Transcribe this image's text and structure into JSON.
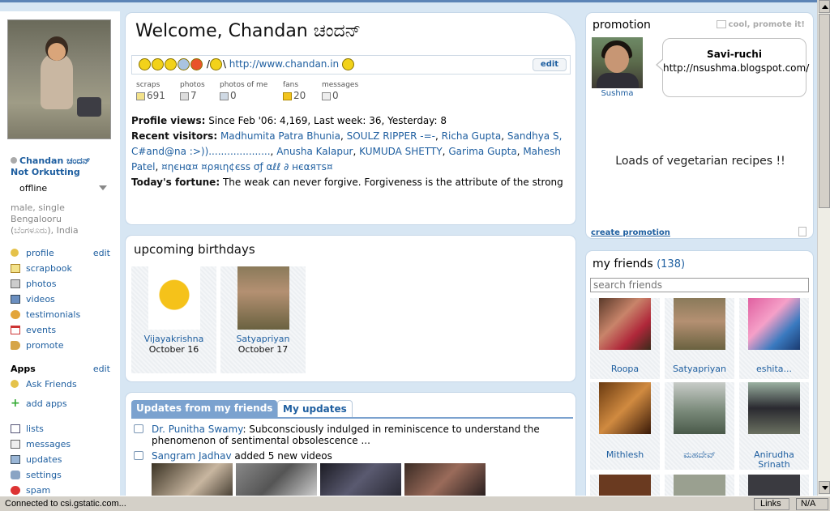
{
  "user": {
    "name": "Chandan ಚಂದನ್",
    "subtitle": "Not Orkutting",
    "status": "offline",
    "info_line1": "male, single",
    "info_line2": "Bengalooru",
    "info_line3": "(ಬೆಂಗಳೂರು), India"
  },
  "nav": {
    "edit": "edit",
    "items": [
      {
        "label": "profile",
        "icon": "person-icon"
      },
      {
        "label": "scrapbook",
        "icon": "notepad-icon"
      },
      {
        "label": "photos",
        "icon": "camera-icon"
      },
      {
        "label": "videos",
        "icon": "film-icon"
      },
      {
        "label": "testimonials",
        "icon": "gear-icon"
      },
      {
        "label": "events",
        "icon": "calendar-icon"
      },
      {
        "label": "promote",
        "icon": "megaphone-icon"
      }
    ],
    "apps_head": "Apps",
    "apps_items": [
      {
        "label": "Ask Friends"
      },
      {
        "label": "add apps"
      }
    ],
    "tools": [
      {
        "label": "lists"
      },
      {
        "label": "messages"
      },
      {
        "label": "updates"
      },
      {
        "label": "settings"
      },
      {
        "label": "spam"
      }
    ]
  },
  "welcome": {
    "title": "Welcome, Chandan ಚಂದನ್",
    "mood_prefix": "/",
    "mood_suffix": "\\",
    "url": "http://www.chandan.in",
    "edit": "edit",
    "stats": [
      {
        "label": "scraps",
        "value": "691"
      },
      {
        "label": "photos",
        "value": "7"
      },
      {
        "label": "photos of me",
        "value": "0"
      },
      {
        "label": "fans",
        "value": "20"
      },
      {
        "label": "messages",
        "value": "0"
      }
    ],
    "profile_views_label": "Profile views:",
    "profile_views_text": "Since Feb '06: 4,169, Last week: 36, Yesterday: 8",
    "recent_visitors_label": "Recent visitors:",
    "recent_visitors": [
      "Madhumita Patra Bhunia",
      "SOULZ RIPPER -=-",
      "Richa Gupta",
      "Sandhya S, C#and@na :>))....................",
      "Anusha Kalapur",
      "KUMUDA SHETTY",
      "Garima Gupta",
      "Mahesh Patel",
      "¤ηєнα¤ ¤ρяιη¢єѕѕ σƒ αℓℓ ∂ нєαятѕ¤"
    ],
    "fortune_label": "Today's fortune:",
    "fortune_text": "The weak can never forgive. Forgiveness is the attribute of the strong"
  },
  "birthdays": {
    "title": "upcoming birthdays",
    "items": [
      {
        "name": "Vijayakrishna",
        "date": "October 16"
      },
      {
        "name": "Satyapriyan",
        "date": "October 17"
      }
    ]
  },
  "updates": {
    "tab_friends": "Updates from my friends",
    "tab_mine": "My updates",
    "item1_name": "Dr. Punitha Swamy",
    "item1_text": ": Subconsciously indulged in reminiscence to understand the phenomenon of sentimental obsolescence ...",
    "item2_name": "Sangram Jadhav",
    "item2_text": " added 5 new videos"
  },
  "promotion": {
    "title": "promotion",
    "cta": "cool, promote it!",
    "person": "Sushma",
    "bubble_title": "Savi-ruchi",
    "bubble_url": "http://nsushma.blogspot.com/",
    "body": "Loads of vegetarian recipes !!",
    "create": "create promotion"
  },
  "friends": {
    "title": "my friends",
    "count": "(138)",
    "search_placeholder": "search friends",
    "items": [
      {
        "name": "Roopa"
      },
      {
        "name": "Satyapriyan"
      },
      {
        "name": "eshita..."
      },
      {
        "name": "Mithlesh"
      },
      {
        "name": "ಮಹದೇವ್"
      },
      {
        "name": "Anirudha Srinath"
      }
    ]
  },
  "statusbar": {
    "text": "Connected to csi.gstatic.com...",
    "links": "Links",
    "na": "N/A"
  }
}
